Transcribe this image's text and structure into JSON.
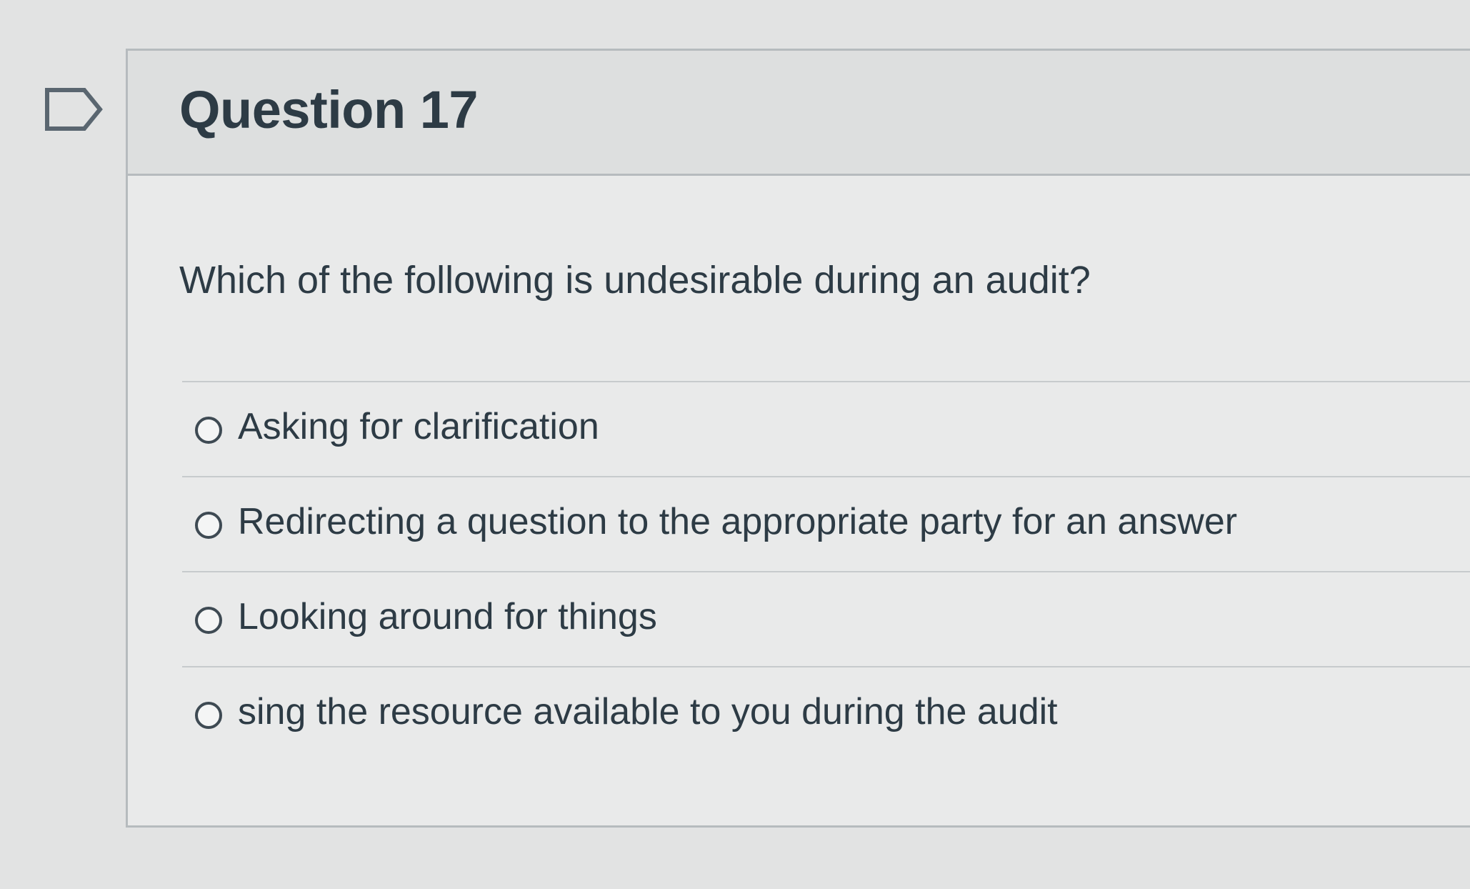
{
  "question": {
    "title": "Question 17",
    "text": "Which of the following is undesirable during an audit?",
    "flag_icon": "flag-icon"
  },
  "answers": [
    {
      "label": "Asking for clarification",
      "selected": false
    },
    {
      "label": "Redirecting a question to the appropriate party for an answer",
      "selected": false
    },
    {
      "label": "Looking around for things",
      "selected": false
    },
    {
      "label": "sing the resource available to you during the audit",
      "selected": false
    }
  ]
}
